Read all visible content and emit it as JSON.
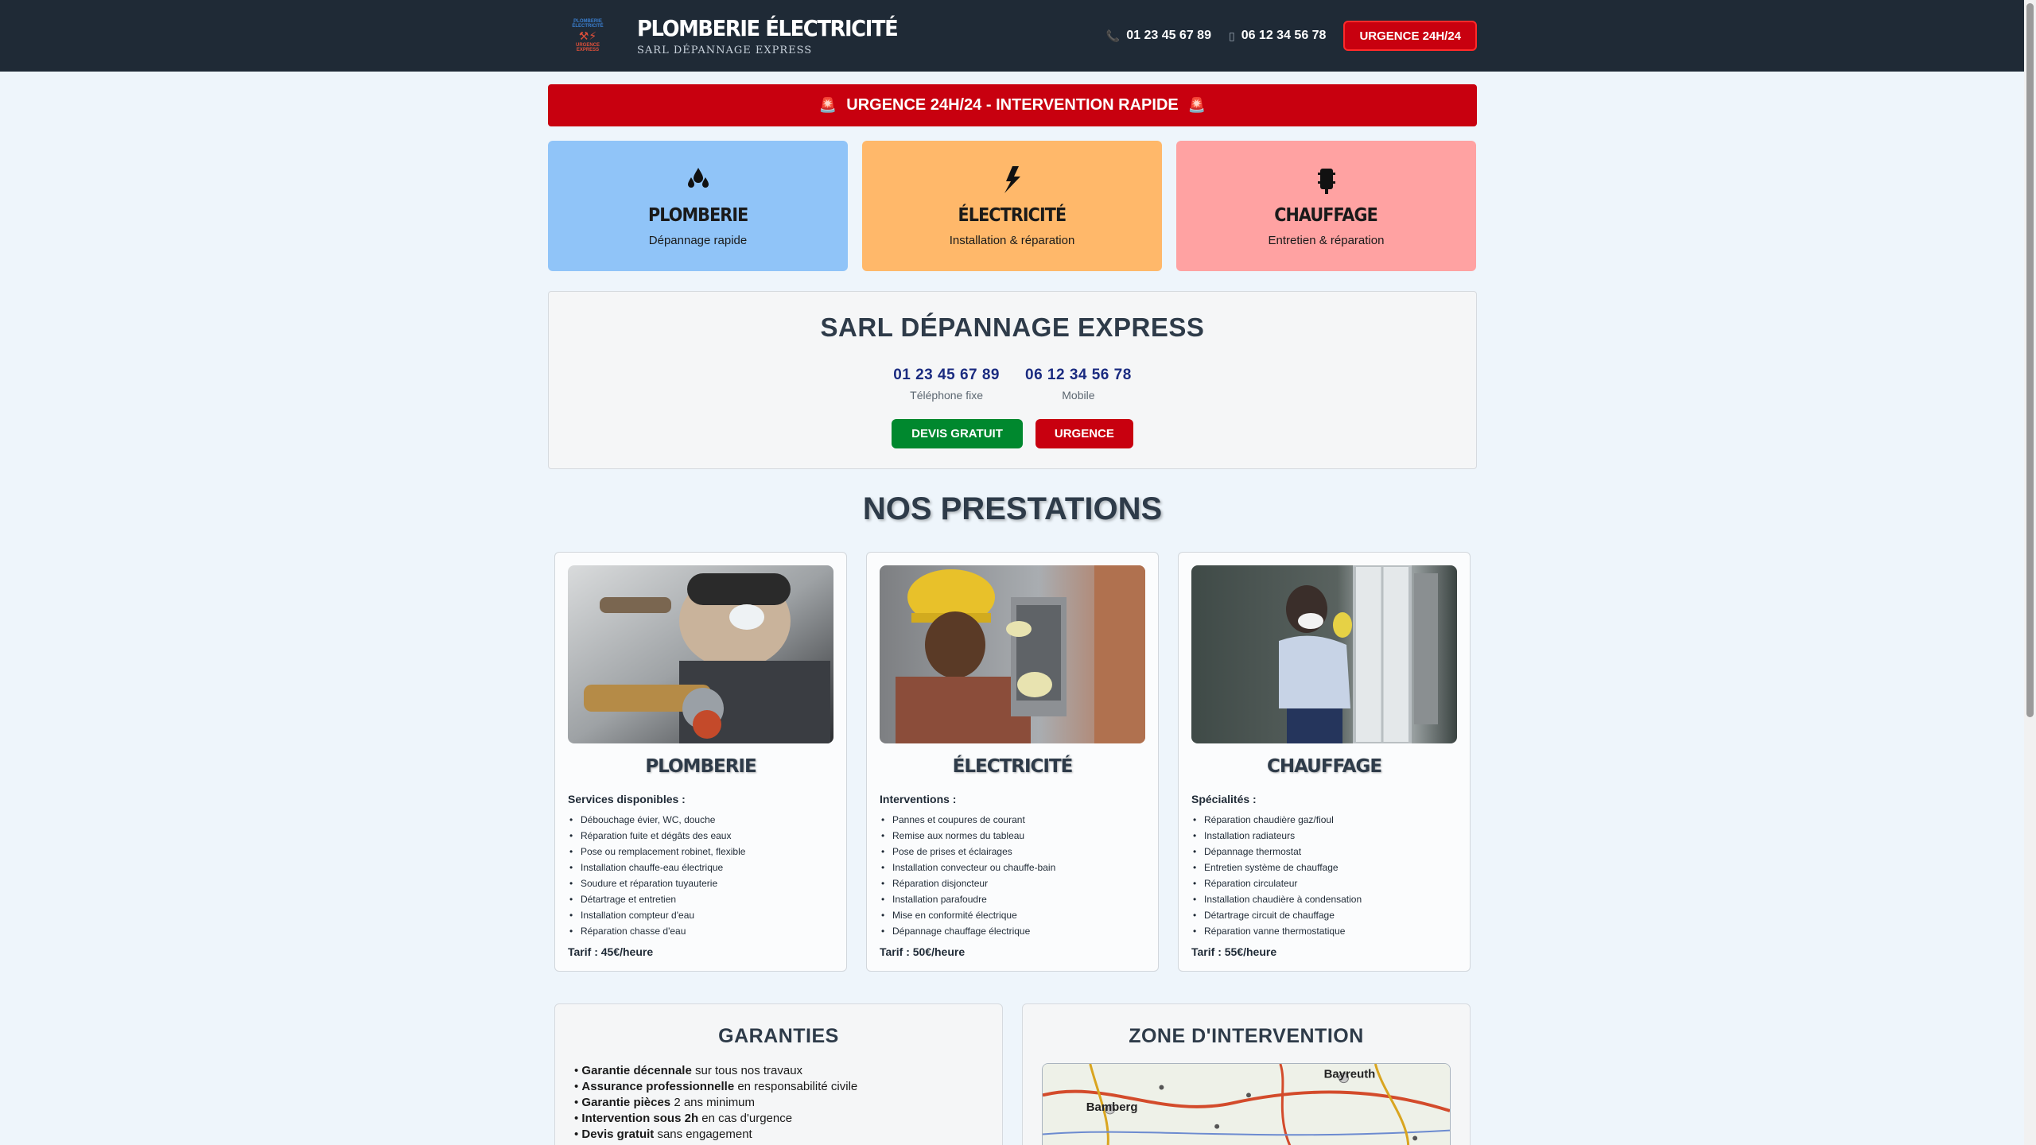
{
  "header": {
    "logo": {
      "line1": "PLOMBERIE ÉLECTRICITÉ",
      "line2": "URGENCE EXPRESS"
    },
    "title": "PLOMBERIE ÉLECTRICITÉ",
    "subtitle": "SARL DÉPANNAGE EXPRESS",
    "phone_fixed": "01 23 45 67 89",
    "phone_mobile": "06 12 34 56 78",
    "urgent_button": "URGENCE 24H/24",
    "icons": {
      "phone": "phone-icon",
      "mobile": "mobile-icon"
    }
  },
  "banner": {
    "text": "URGENCE 24H/24 - INTERVENTION RAPIDE",
    "icon": "siren-icon"
  },
  "services": [
    {
      "icon": "water-drops-icon",
      "title": "PLOMBERIE",
      "subtitle": "Dépannage rapide",
      "color": "#90c4f8"
    },
    {
      "icon": "lightning-icon",
      "title": "ÉLECTRICITÉ",
      "subtitle": "Installation & réparation",
      "color": "#ffb86a"
    },
    {
      "icon": "radiator-icon",
      "title": "CHAUFFAGE",
      "subtitle": "Entretien & réparation",
      "color": "#ffa2a2"
    }
  ],
  "company": {
    "name": "SARL DÉPANNAGE EXPRESS",
    "phones": [
      {
        "number": "01 23 45 67 89",
        "label": "Téléphone fixe"
      },
      {
        "number": "06 12 34 56 78",
        "label": "Mobile"
      }
    ],
    "quote_button": "DEVIS GRATUIT",
    "urgent_button": "URGENCE"
  },
  "prestations": {
    "title": "NOS PRESTATIONS",
    "cards": [
      {
        "title": "PLOMBERIE",
        "lead": "Services disponibles :",
        "items": [
          "Débouchage évier, WC, douche",
          "Réparation fuite et dégâts des eaux",
          "Pose ou remplacement robinet, flexible",
          "Installation chauffe-eau électrique",
          "Soudure et réparation tuyauterie",
          "Détartrage et entretien",
          "Installation compteur d'eau",
          "Réparation chasse d'eau"
        ],
        "rate": "Tarif : 45€/heure"
      },
      {
        "title": "ÉLECTRICITÉ",
        "lead": "Interventions :",
        "items": [
          "Pannes et coupures de courant",
          "Remise aux normes du tableau",
          "Pose de prises et éclairages",
          "Installation convecteur ou chauffe-bain",
          "Réparation disjoncteur",
          "Installation parafoudre",
          "Mise en conformité électrique",
          "Dépannage chauffage électrique"
        ],
        "rate": "Tarif : 50€/heure"
      },
      {
        "title": "CHAUFFAGE",
        "lead": "Spécialités :",
        "items": [
          "Réparation chaudière gaz/fioul",
          "Installation radiateurs",
          "Dépannage thermostat",
          "Entretien système de chauffage",
          "Réparation circulateur",
          "Installation chaudière à condensation",
          "Détartrage circuit de chauffage",
          "Réparation vanne thermostatique"
        ],
        "rate": "Tarif : 55€/heure"
      }
    ]
  },
  "guarantees": {
    "title": "GARANTIES",
    "items": [
      {
        "bold": "Garantie décennale",
        "rest": " sur tous nos travaux"
      },
      {
        "bold": "Assurance professionnelle",
        "rest": " en responsabilité civile"
      },
      {
        "bold": "Garantie pièces",
        "rest": " 2 ans minimum"
      },
      {
        "bold": "Intervention sous 2h",
        "rest": " en cas d'urgence"
      },
      {
        "bold": "Devis gratuit",
        "rest": " sans engagement"
      }
    ]
  },
  "zone": {
    "title": "ZONE D'INTERVENTION",
    "map_labels": [
      "Bayreuth",
      "Bamberg"
    ]
  }
}
